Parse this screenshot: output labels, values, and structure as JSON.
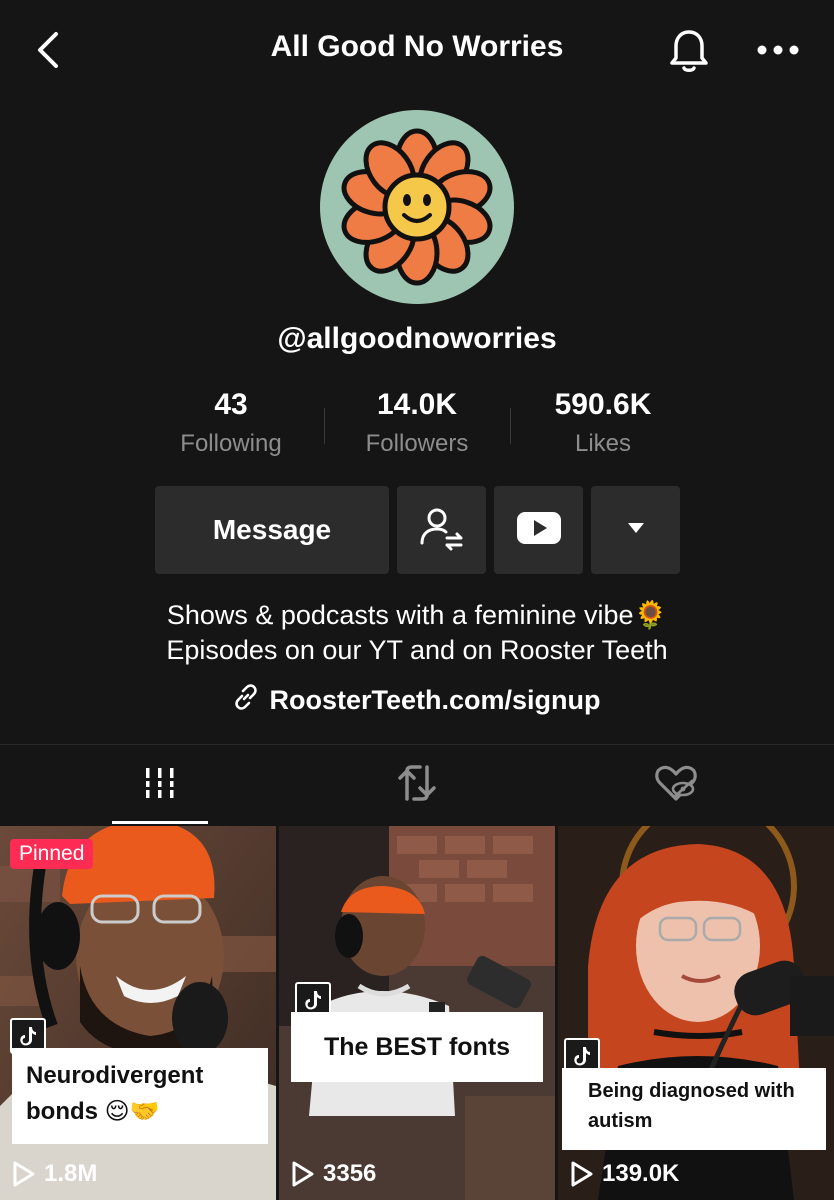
{
  "header": {
    "title": "All Good No Worries",
    "back_icon": "chevron-left-icon",
    "bell_icon": "bell-icon",
    "more_icon": "more-dots-icon"
  },
  "profile": {
    "handle": "@allgoodnoworries",
    "avatar_colors": {
      "bg": "#9ec4b2",
      "petal": "#ef7b45",
      "center": "#f6c84a"
    }
  },
  "stats": [
    {
      "value": "43",
      "label": "Following"
    },
    {
      "value": "14.0K",
      "label": "Followers"
    },
    {
      "value": "590.6K",
      "label": "Likes"
    }
  ],
  "actions": {
    "message_label": "Message",
    "follow_icon": "user-switch-icon",
    "youtube_icon": "youtube-icon",
    "dropdown_icon": "caret-down-icon"
  },
  "bio": {
    "line1": "Shows & podcasts with a feminine vibe🌻",
    "line2": "Episodes on our YT and on Rooster Teeth",
    "link": "RoosterTeeth.com/signup"
  },
  "tabs": [
    {
      "name": "videos",
      "icon": "grid-bars-icon",
      "active": true
    },
    {
      "name": "reposts",
      "icon": "repost-icon",
      "active": false
    },
    {
      "name": "liked",
      "icon": "heart-hidden-icon",
      "active": false
    }
  ],
  "videos": [
    {
      "pinned_label": "Pinned",
      "caption_line1": "Neurodivergent",
      "caption_line2": "bonds 😌🤝",
      "views": "1.8M"
    },
    {
      "caption_line1": "The BEST fonts",
      "views": "3356"
    },
    {
      "caption_line1": "Being diagnosed with",
      "caption_line2": "autism",
      "views": "139.0K"
    }
  ],
  "colors": {
    "background": "#151515",
    "button": "#2c2c2c",
    "muted_text": "#8d8d8d",
    "pinned": "#fe2c55"
  }
}
